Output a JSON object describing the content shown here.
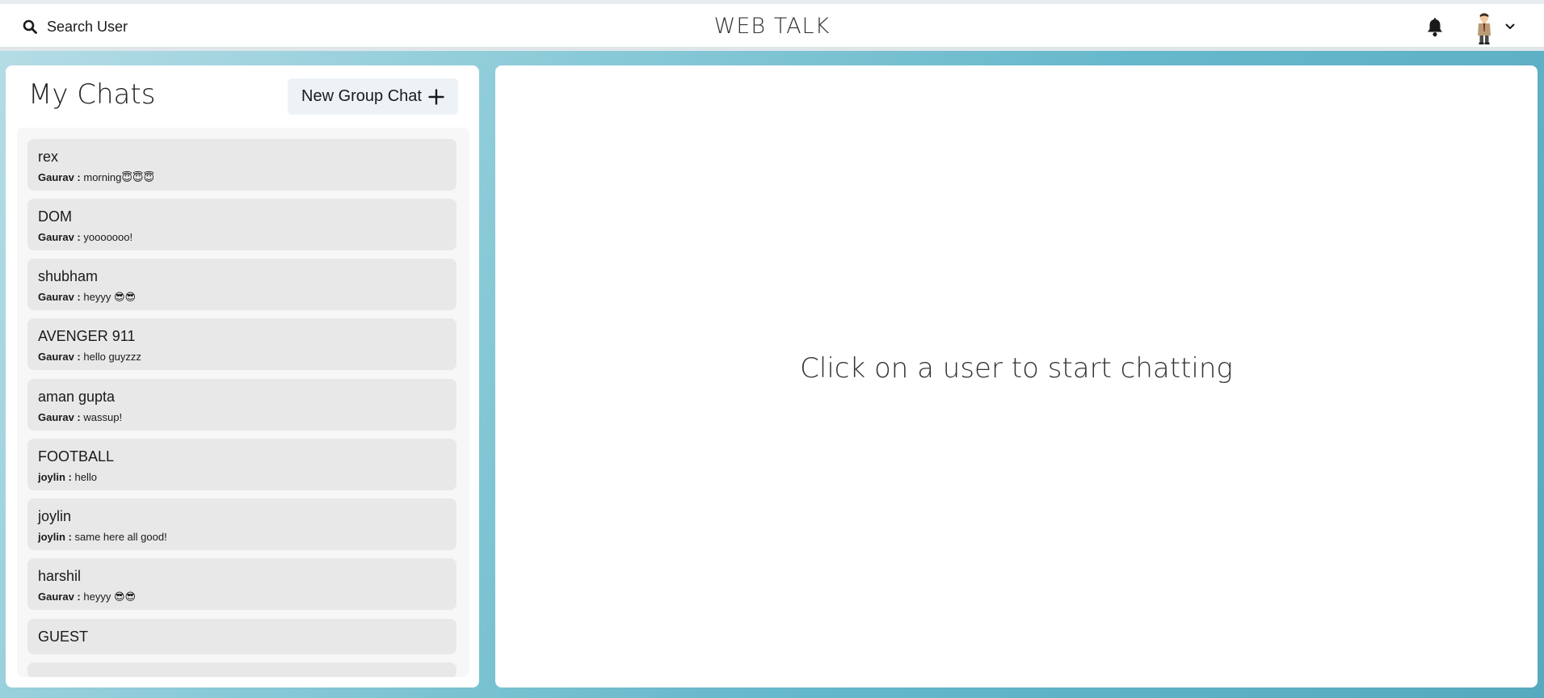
{
  "header": {
    "search_label": "Search User",
    "app_title": "WEB TALK"
  },
  "sidebar": {
    "title": "My Chats",
    "new_group_label": "New Group Chat",
    "chats": [
      {
        "name": "rex",
        "sender": "Gaurav :",
        "message": "morning😇😇😇"
      },
      {
        "name": "DOM",
        "sender": "Gaurav :",
        "message": "yooooooo!"
      },
      {
        "name": "shubham",
        "sender": "Gaurav :",
        "message": "heyyy 😎😎"
      },
      {
        "name": "AVENGER 911",
        "sender": "Gaurav :",
        "message": "hello guyzzz"
      },
      {
        "name": "aman gupta",
        "sender": "Gaurav :",
        "message": "wassup!"
      },
      {
        "name": "FOOTBALL",
        "sender": "joylin :",
        "message": "hello"
      },
      {
        "name": "joylin",
        "sender": "joylin :",
        "message": "same here all good!"
      },
      {
        "name": "harshil",
        "sender": "Gaurav :",
        "message": "heyyy 😎😎"
      },
      {
        "name": "GUEST",
        "sender": "",
        "message": ""
      }
    ]
  },
  "main": {
    "empty_message": "Click on a user to start chatting"
  },
  "colors": {
    "accent_bg": "#66b8cb",
    "chat_item_bg": "#e8e8e8",
    "button_bg": "#edf2f7"
  },
  "icons": {
    "search": "search-icon",
    "bell": "bell-icon",
    "plus": "plus-icon",
    "chevron": "chevron-down-icon"
  }
}
